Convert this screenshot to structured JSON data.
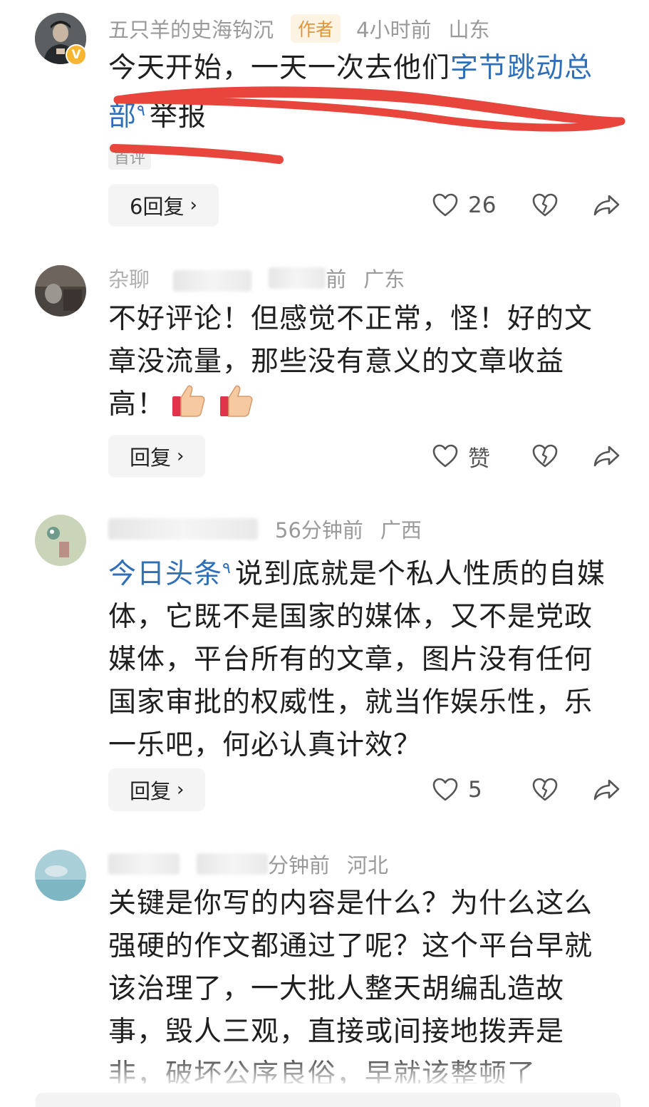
{
  "comments": [
    {
      "username": "五只羊的史海钩沉",
      "author_badge": "作者",
      "time": "4小时前",
      "location": "山东",
      "text_before": "今天开始，一天一次去他们",
      "link_text": "字节跳动总部",
      "text_after": "举报",
      "first_tag": "首评",
      "reply_label": "6回复",
      "likes": "26"
    },
    {
      "username_partial": "杂聊",
      "time_partial": "前",
      "location": "广东",
      "text": "不好评论！但感觉不正常，怪！好的文章没流量，那些没有意义的文章收益高！",
      "reply_label": "回复",
      "likes": "赞"
    },
    {
      "time": "56分钟前",
      "location": "广西",
      "link_text": "今日头条",
      "text": "说到底就是个私人性质的自媒体，它既不是国家的媒体，又不是党政媒体，平台所有的文章，图片没有任何国家审批的权威性，就当作娱乐性，乐一乐吧，何必认真计效？",
      "reply_label": "回复",
      "likes": "5"
    },
    {
      "time_partial": "分钟前",
      "location": "河北",
      "text": "关键是你写的内容是什么？为什么这么强硬的作文都通过了呢？这个平台早就该治理了，一大批人整天胡编乱造故事，毁人三观，直接或间接地拨弄是非，破坏公序良俗，早就该整顿了"
    }
  ],
  "icons": {
    "like": "heart-outline-icon",
    "dislike": "broken-heart-icon",
    "share": "share-arrow-icon",
    "chevron": "chevron-right-icon",
    "verified": "verified-v-icon",
    "search_mark": "search-mark-icon"
  },
  "colors": {
    "link": "#2e6fb8",
    "author_badge_bg": "#fdf3e3",
    "author_badge_text": "#e0953b",
    "annotation_red": "#e8453c",
    "verified_badge": "#f7b531"
  },
  "glyphs": {
    "chevron": "›",
    "search_mark": "٩"
  }
}
